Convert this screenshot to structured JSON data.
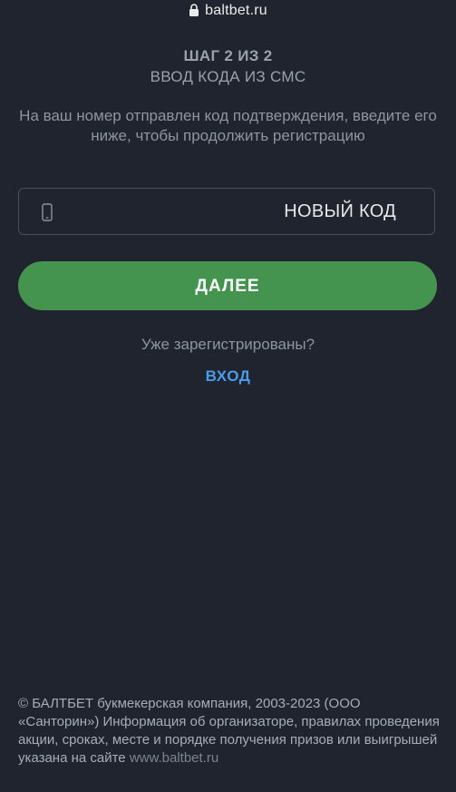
{
  "browser": {
    "url": "baltbet.ru"
  },
  "registration": {
    "step_title": "ШАГ 2 ИЗ 2",
    "step_subtitle": "ВВОД КОДА ИЗ СМС",
    "description": "На ваш номер отправлен код подтверждения, введите его ниже, чтобы продолжить регистрацию",
    "code_field": {
      "value": "",
      "placeholder": "",
      "icon": "phone-icon"
    },
    "new_code_label": "НОВЫЙ КОД",
    "next_button_label": "ДАЛЕЕ",
    "already_registered": "Уже зарегистрированы?",
    "login_label": "ВХОД"
  },
  "footer": {
    "text": "© БАЛТБЕТ букмекерская компания, 2003-2023 (ООО «Санторин») Информация об организаторе, правилах проведения акции, сроках, месте и порядке получения призов или выигрышей указана на сайте ",
    "link": "www.baltbet.ru"
  },
  "colors": {
    "background": "#1f242e",
    "accent_green": "#449450",
    "link_blue": "#4c9be8"
  }
}
